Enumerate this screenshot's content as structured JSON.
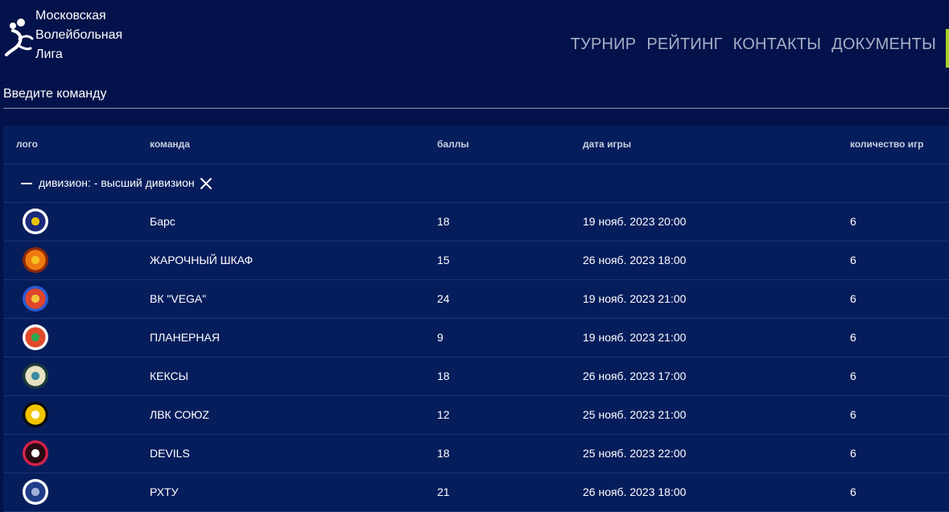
{
  "brand": {
    "line1": "Московская",
    "line2": "Волейбольная",
    "line3": "Лига"
  },
  "nav": {
    "items": [
      "ТУРНИР",
      "РЕЙТИНГ",
      "КОНТАКТЫ",
      "ДОКУМЕНТЫ"
    ]
  },
  "search": {
    "placeholder": "Введите команду"
  },
  "table": {
    "headers": {
      "logo": "лого",
      "team": "команда",
      "points": "баллы",
      "date": "дата игры",
      "games": "количество игр"
    },
    "group_label": "дивизион: - высший дивизион",
    "rows": [
      {
        "team": "Барс",
        "points": "18",
        "date": "19 нояб. 2023 20:00",
        "games": "6",
        "logo_icon": "bars-team-logo",
        "logo_colors": [
          "#ffffff",
          "#1b2a7a",
          "#e8c400"
        ]
      },
      {
        "team": "ЖАРОЧНЫЙ ШКАФ",
        "points": "15",
        "date": "26 нояб. 2023 18:00",
        "games": "6",
        "logo_icon": "fire-team-logo",
        "logo_colors": [
          "#8a2a0b",
          "#f07a12",
          "#f5c224"
        ]
      },
      {
        "team": "ВК \"VEGA\"",
        "points": "24",
        "date": "19 нояб. 2023 21:00",
        "games": "6",
        "logo_icon": "vega-team-logo",
        "logo_colors": [
          "#2a5bd1",
          "#e0462b",
          "#f2c43a"
        ]
      },
      {
        "team": "ПЛАНЕРНАЯ",
        "points": "9",
        "date": "19 нояб. 2023 21:00",
        "games": "6",
        "logo_icon": "planernaya-team-logo",
        "logo_colors": [
          "#ffffff",
          "#e04a2a",
          "#2ea84f"
        ]
      },
      {
        "team": "КЕКСЫ",
        "points": "18",
        "date": "26 нояб. 2023 17:00",
        "games": "6",
        "logo_icon": "keksy-team-logo",
        "logo_colors": [
          "#1d3b3a",
          "#e7e1c2",
          "#3a8ca0"
        ]
      },
      {
        "team": "ЛВК СОЮZ",
        "points": "12",
        "date": "25 нояб. 2023 21:00",
        "games": "6",
        "logo_icon": "soyuz-team-logo",
        "logo_colors": [
          "#0b0b0b",
          "#f2c400",
          "#ffffff"
        ]
      },
      {
        "team": "DEVILS",
        "points": "18",
        "date": "25 нояб. 2023 22:00",
        "games": "6",
        "logo_icon": "devils-team-logo",
        "logo_colors": [
          "#d4224a",
          "#2a0a12",
          "#ffffff"
        ]
      },
      {
        "team": "РХТУ",
        "points": "21",
        "date": "26 нояб. 2023 18:00",
        "games": "6",
        "logo_icon": "rhtu-team-logo",
        "logo_colors": [
          "#ffffff",
          "#1f3c8a",
          "#9fb0d8"
        ]
      }
    ]
  },
  "colors": {
    "background": "#03124a",
    "table_background": "#061d5c",
    "accent": "#a7d129",
    "nav_text": "#a6aec7"
  }
}
